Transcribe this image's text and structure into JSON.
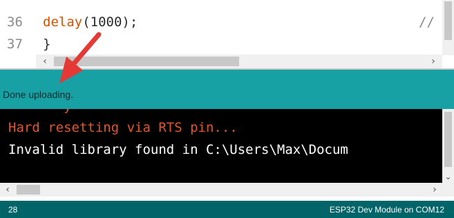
{
  "editor": {
    "lines": [
      {
        "number": "36",
        "code_kw": "delay",
        "code_rest": "(1000);",
        "comment": "//"
      },
      {
        "number": "37",
        "code_rest": "}"
      }
    ]
  },
  "status": {
    "message": "Done uploading."
  },
  "console": {
    "lines": [
      "Hard resetting via RTS pin...",
      "Invalid library found in C:\\Users\\Max\\Docum"
    ]
  },
  "footer": {
    "line_number": "28",
    "board": "ESP32 Dev Module on COM12"
  },
  "colors": {
    "teal": "#17a1a5",
    "dark_teal": "#006468",
    "console_orange": "#e2572a",
    "annotation_red": "#e53935"
  }
}
